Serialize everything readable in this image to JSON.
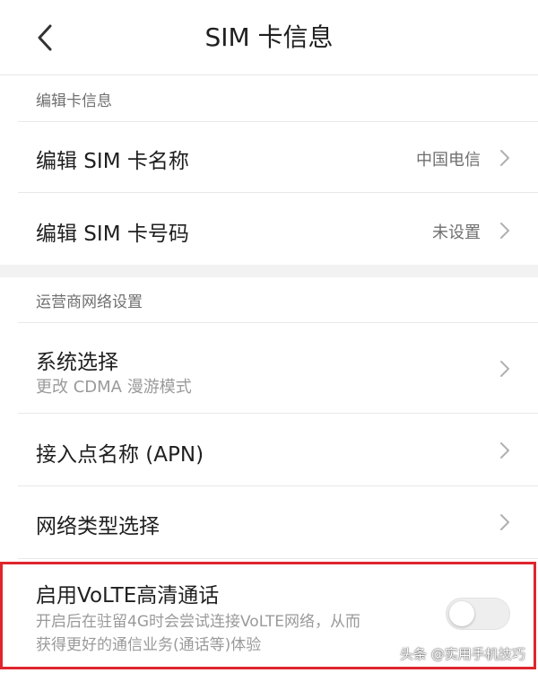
{
  "header": {
    "title": "SIM  卡信息",
    "back_icon": "chevron-left-icon"
  },
  "section_card": {
    "label": "编辑卡信息",
    "items": [
      {
        "title": "编辑 SIM 卡名称",
        "value": "中国电信"
      },
      {
        "title": "编辑 SIM 卡号码",
        "value": "未设置"
      }
    ]
  },
  "section_network": {
    "label": "运营商网络设置",
    "items": [
      {
        "title": "系统选择",
        "subtitle": "更改 CDMA 漫游模式"
      },
      {
        "title": "接入点名称 (APN)"
      },
      {
        "title": "网络类型选择"
      }
    ]
  },
  "volte": {
    "title": "启用VoLTE高清通话",
    "desc_line1": "开启后在驻留4G时会尝试连接VoLTE网络，从而",
    "desc_line2": "获得更好的通信业务(通话等)体验",
    "enabled": false
  },
  "watermark": "头条 @实用手机技巧",
  "colors": {
    "highlight": "#e0252d",
    "divider": "#e8e8e8",
    "gap": "#f2f2f2"
  }
}
